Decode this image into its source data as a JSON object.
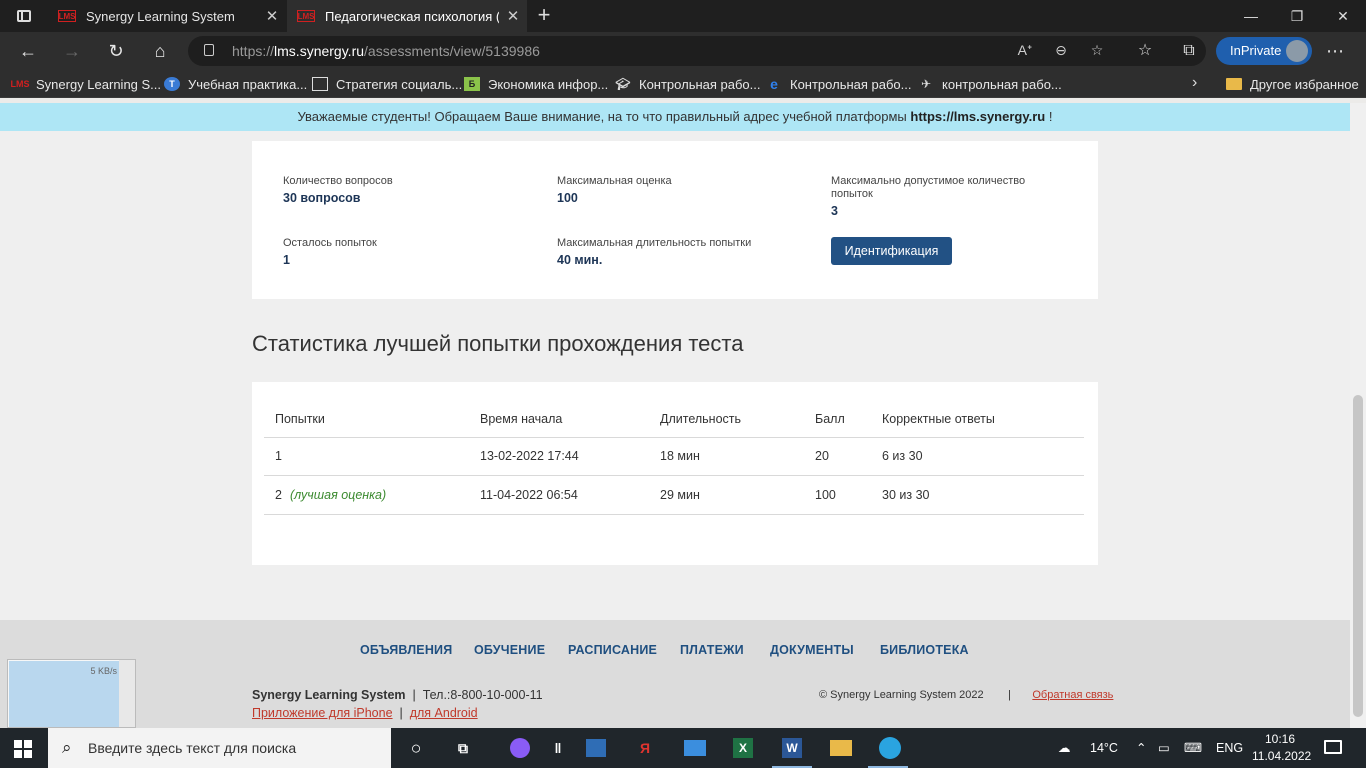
{
  "browser": {
    "tabs": [
      {
        "title": "Synergy Learning System",
        "favicon": "LMS"
      },
      {
        "title": "Педагогическая психология (Об",
        "favicon": "LMS"
      }
    ],
    "url_prefix": "https://",
    "url_host": "lms.synergy.ru",
    "url_path": "/assessments/view/5139986",
    "inprivate_label": "InPrivate"
  },
  "bookmarks": [
    {
      "label": "Synergy Learning S...",
      "icon": "LMS",
      "color": "#d02020"
    },
    {
      "label": "Учебная практика...",
      "icon": "circle-icon",
      "color": "#3a7bd5"
    },
    {
      "label": "Стратегия социаль...",
      "icon": "doc-icon",
      "color": "#dddddd"
    },
    {
      "label": "Экономика инфор...",
      "icon": "Б",
      "color": "#8bc34a"
    },
    {
      "label": "Контрольная рабо...",
      "icon": "cap-icon",
      "color": "#dddddd"
    },
    {
      "label": "Контрольная рабо...",
      "icon": "e-icon",
      "color": "#2f80ed"
    },
    {
      "label": "контрольная рабо...",
      "icon": "bird-icon",
      "color": "#dddddd"
    }
  ],
  "bookmarks_other": "Другое избранное",
  "notice": {
    "text": "Уважаемые студенты! Обращаем Ваше внимание, на то что правильный адрес учебной платформы",
    "link": "https://lms.synergy.ru",
    "suffix": " !"
  },
  "info": {
    "questions_label": "Количество вопросов",
    "questions_value": "30 вопросов",
    "max_score_label": "Максимальная оценка",
    "max_score_value": "100",
    "max_attempts_label": "Максимально допустимое количество попыток",
    "max_attempts_value": "3",
    "remaining_label": "Осталось попыток",
    "remaining_value": "1",
    "duration_label": "Максимальная длительность попытки",
    "duration_value": "40 мин.",
    "identify_button": "Идентификация"
  },
  "stats": {
    "title": "Статистика лучшей попытки прохождения теста",
    "headers": [
      "Попытки",
      "Время начала",
      "Длительность",
      "Балл",
      "Корректные ответы"
    ],
    "rows": [
      {
        "attempt": "1",
        "note": "",
        "start": "13-02-2022 17:44",
        "duration": "18 мин",
        "score": "20",
        "correct": "6 из 30"
      },
      {
        "attempt": "2",
        "note": "(лучшая оценка)",
        "start": "11-04-2022 06:54",
        "duration": "29 мин",
        "score": "100",
        "correct": "30 из 30"
      }
    ]
  },
  "footer": {
    "nav": [
      "ОБЪЯВЛЕНИЯ",
      "ОБУЧЕНИЕ",
      "РАСПИСАНИЕ",
      "ПЛАТЕЖИ",
      "ДОКУМЕНТЫ",
      "БИБЛИОТЕКА"
    ],
    "brand": "Synergy Learning System",
    "separator": "|",
    "phone": "Тел.:8-800-10-000-11",
    "iphone_link": "Приложение для iPhone",
    "android_link": "для Android",
    "copyright": "© Synergy Learning System 2022",
    "feedback_link": "Обратная связь"
  },
  "widget": {
    "speed": "5 KB/s"
  },
  "taskbar": {
    "search_placeholder": "Введите здесь текст для поиска",
    "temperature": "14°C",
    "lang": "ENG",
    "time": "10:16",
    "date": "11.04.2022"
  }
}
